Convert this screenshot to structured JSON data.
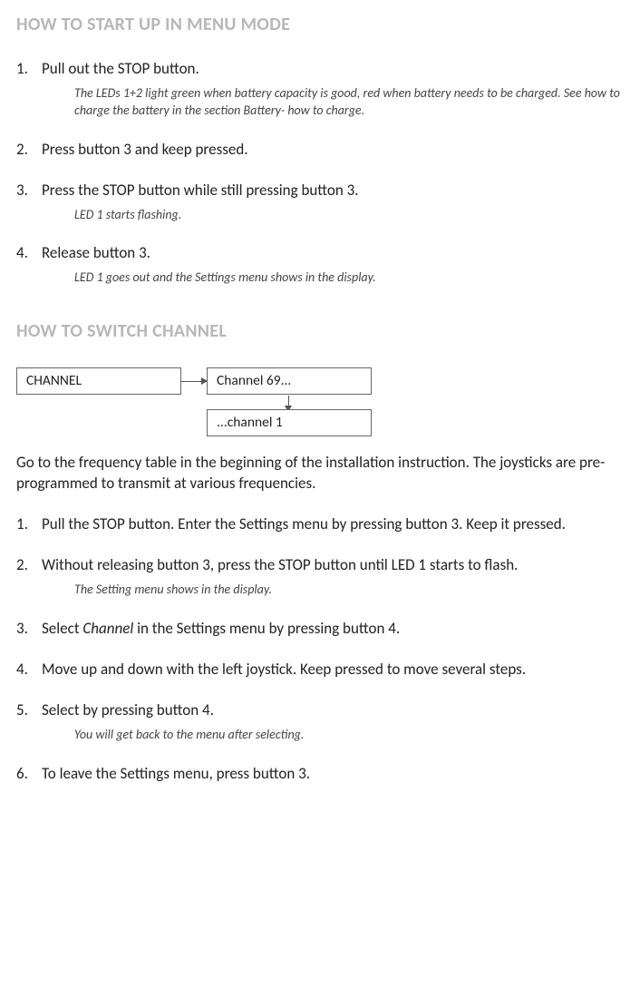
{
  "section1": {
    "heading": "HOW TO START UP IN MENU MODE",
    "steps": [
      {
        "num": "1.",
        "text": "Pull out the STOP button.",
        "note": "The  LEDs 1+2 light green when battery capacity is good, red when battery needs to be charged. See how to charge the battery in the section Battery- how to charge."
      },
      {
        "num": "2.",
        "text": "Press button 3 and keep pressed.",
        "note": ""
      },
      {
        "num": "3.",
        "text": "Press the STOP button while still pressing button 3.",
        "note": "LED 1 starts flashing."
      },
      {
        "num": "4.",
        "text": "Release button 3.",
        "note": "LED 1 goes out and the Settings menu shows in the display."
      }
    ]
  },
  "section2": {
    "heading": "HOW TO SWITCH CHANNEL",
    "diagram": {
      "box1": "CHANNEL",
      "box2": "Channel 69...",
      "box3": "...channel 1"
    },
    "intro": "Go to the frequency table in the beginning of the installation instruction. The joysticks are pre-programmed to transmit at various frequencies.",
    "steps": [
      {
        "num": "1.",
        "text": "Pull the STOP button. Enter the Settings menu by pressing button 3. Keep it pressed.",
        "note": ""
      },
      {
        "num": "2.",
        "text": "Without releasing button 3, press the STOP button until LED 1 starts to flash.",
        "note": "The Setting menu shows in the display."
      },
      {
        "num": "3.",
        "text_prefix": "Select ",
        "text_italic": "Channel",
        "text_suffix": " in the Settings menu by pressing button 4.",
        "note": ""
      },
      {
        "num": "4.",
        "text": "Move up and down with the left joystick. Keep pressed to move several steps.",
        "note": ""
      },
      {
        "num": "5.",
        "text": "Select by pressing button 4.",
        "note": "You will get back to the menu after selecting."
      },
      {
        "num": "6.",
        "text": "To leave the Settings menu, press button 3.",
        "note": ""
      }
    ]
  }
}
